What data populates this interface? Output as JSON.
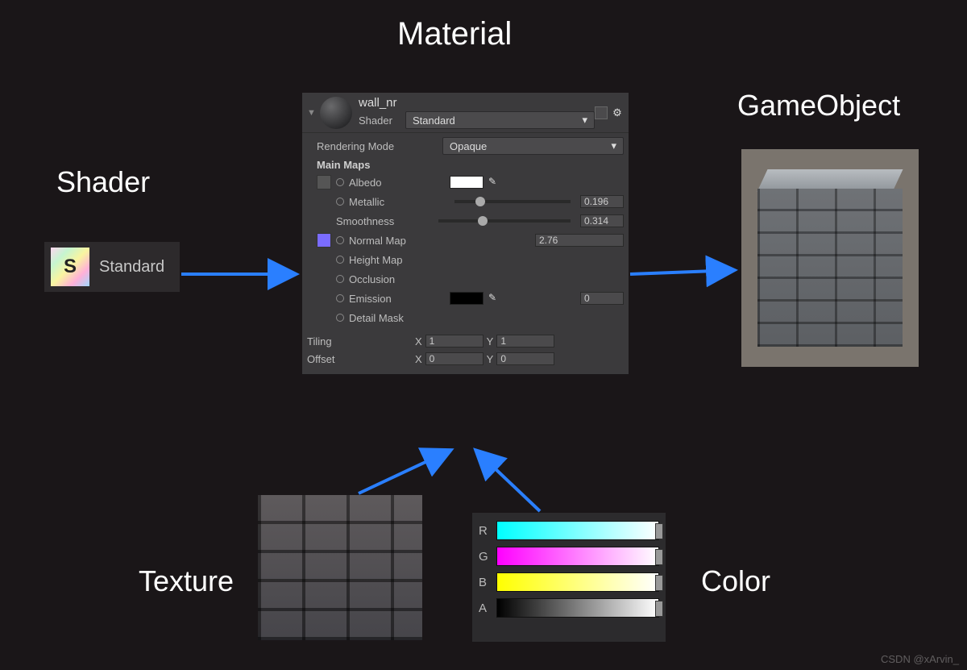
{
  "labels": {
    "material": "Material",
    "shader": "Shader",
    "gameobject": "GameObject",
    "texture": "Texture",
    "color": "Color"
  },
  "shader_box": {
    "icon_letter": "S",
    "name": "Standard"
  },
  "material_panel": {
    "name": "wall_nr",
    "shader_label": "Shader",
    "shader_value": "Standard",
    "rendering_mode_label": "Rendering Mode",
    "rendering_mode_value": "Opaque",
    "section_main_maps": "Main Maps",
    "albedo_label": "Albedo",
    "metallic_label": "Metallic",
    "metallic_value": "0.196",
    "smoothness_label": "Smoothness",
    "smoothness_value": "0.314",
    "normal_label": "Normal Map",
    "normal_value": "2.76",
    "height_label": "Height Map",
    "occlusion_label": "Occlusion",
    "emission_label": "Emission",
    "emission_value": "0",
    "detail_mask_label": "Detail Mask",
    "tiling_label": "Tiling",
    "tiling_x": "1",
    "tiling_y": "1",
    "offset_label": "Offset",
    "offset_x": "0",
    "offset_y": "0",
    "x_label": "X",
    "y_label": "Y"
  },
  "color_channels": {
    "r": "R",
    "g": "G",
    "b": "B",
    "a": "A"
  },
  "watermark": "CSDN @xArvin_"
}
